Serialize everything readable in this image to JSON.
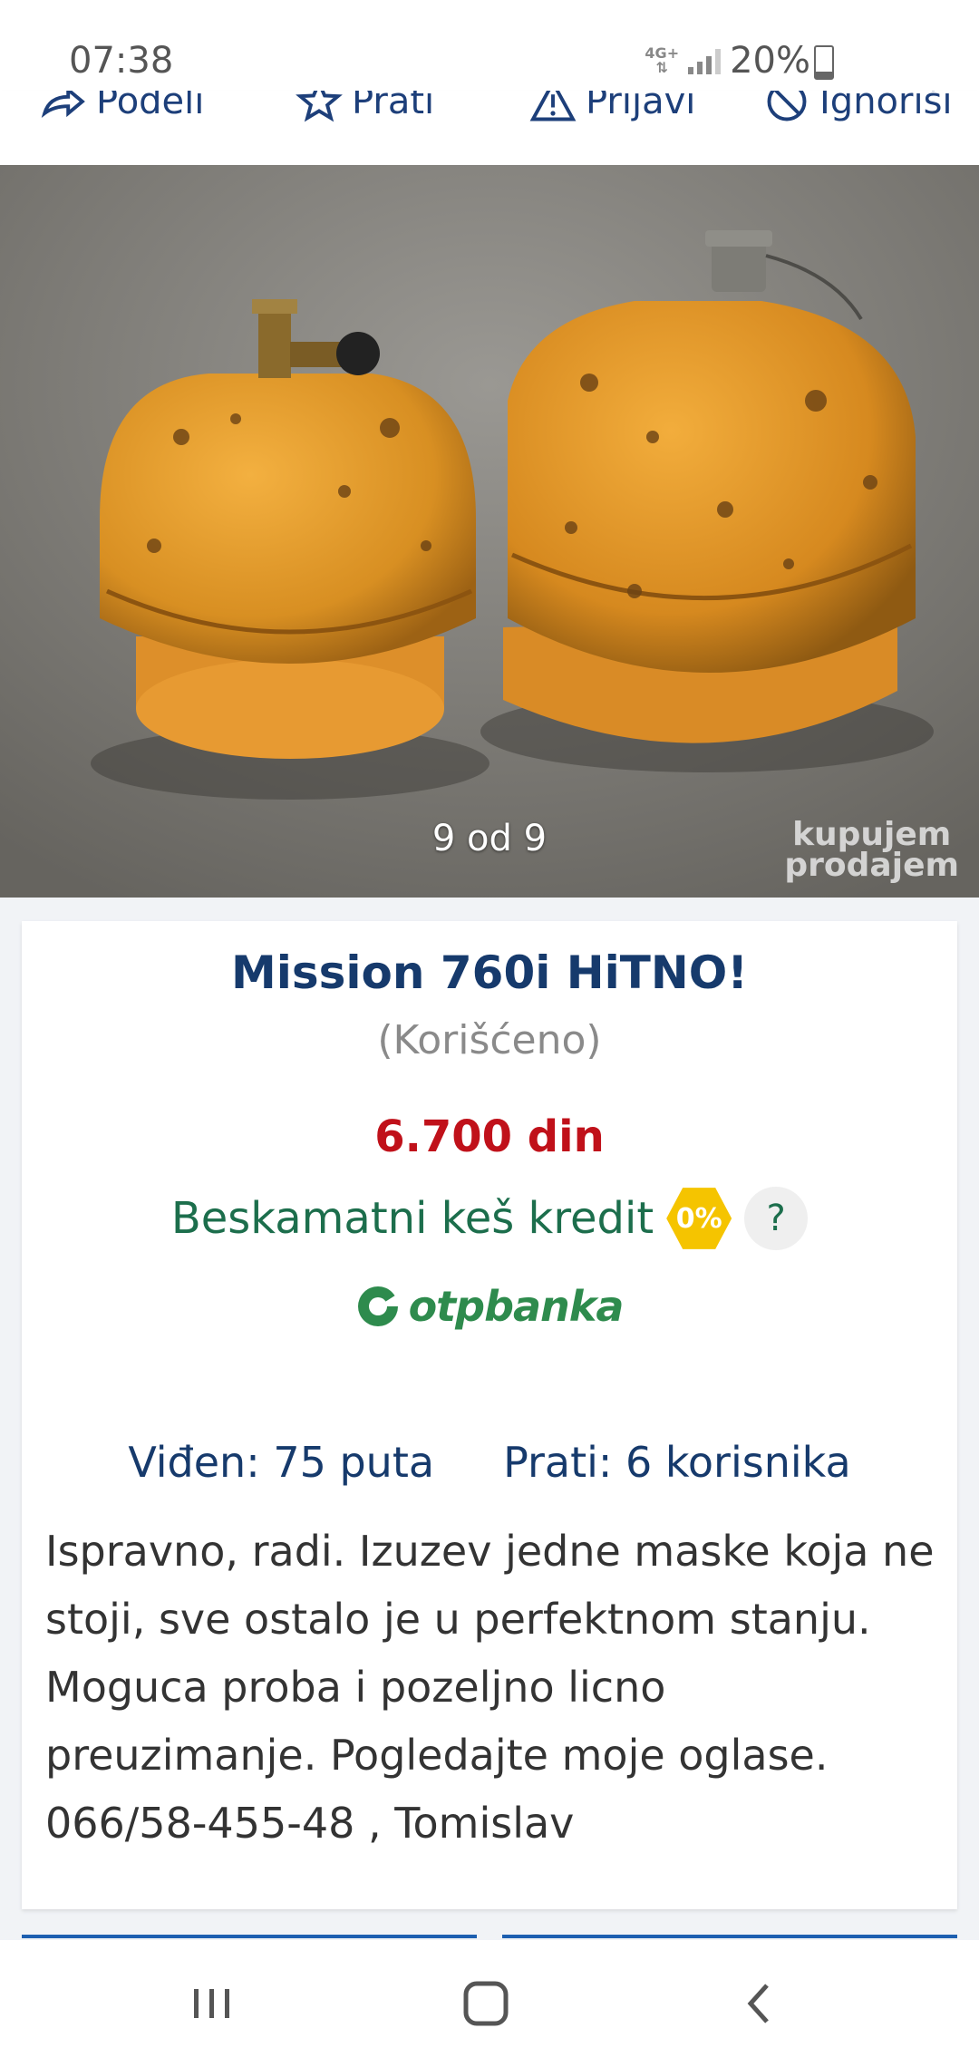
{
  "status_bar": {
    "time": "07:38",
    "network": "4G+",
    "battery": "20%"
  },
  "action_bar": {
    "share_label": "Podeli",
    "follow_label": "Prati",
    "report_label": "Prijavi",
    "ignore_label": "Ignoriši"
  },
  "gallery": {
    "counter": "9 od 9",
    "watermark_line1": "kupujem",
    "watermark_line2": "prodajem"
  },
  "listing": {
    "title": "Mission 760i HiTNO!",
    "condition": "(Korišćeno)",
    "price": "6.700 din",
    "credit_text": "Beskamatni keš kredit",
    "credit_badge": "0%",
    "credit_help": "?",
    "bank_name": "otpbanka",
    "views": "Viđen: 75 puta",
    "followers": "Prati: 6 korisnika",
    "description": "Ispravno, radi. Izuzev jedne maske koja ne stoji, sve ostalo je u perfektnom stanju. Moguca proba i pozeljno licno preuzimanje. Pogledajte moje oglase. 066/58-455-48 , Tomislav"
  },
  "colors": {
    "title": "#163a6c",
    "price": "#c0111a",
    "credit": "#1c6e4c",
    "badge": "#f5c400",
    "bank": "#2e8b4d"
  }
}
